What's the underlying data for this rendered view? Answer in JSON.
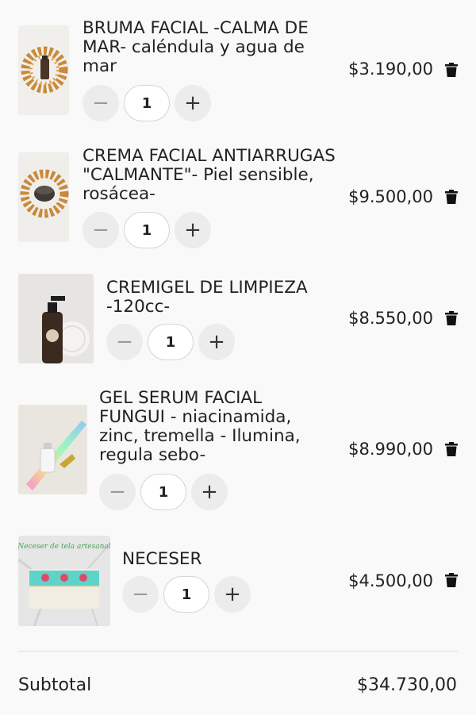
{
  "cart": {
    "items": [
      {
        "title": "BRUMA FACIAL -CALMA DE MAR- caléndula y agua de mar",
        "quantity": "1",
        "price": "$3.190,00"
      },
      {
        "title": "CREMA FACIAL ANTIARRUGAS \"CALMANTE\"- Piel sensible, rosácea-",
        "quantity": "1",
        "price": "$9.500,00"
      },
      {
        "title": "CREMIGEL DE LIMPIEZA -120cc-",
        "quantity": "1",
        "price": "$8.550,00"
      },
      {
        "title": "GEL SERUM FACIAL FUNGUI - niacinamida, zinc, tremella - Ilumina, regula sebo-",
        "quantity": "1",
        "price": "$8.990,00"
      },
      {
        "title": "NECESER",
        "quantity": "1",
        "price": "$4.500,00",
        "image_text": "Neceser de tela artesanal"
      }
    ],
    "subtotal_label": "Subtotal",
    "subtotal_value": "$34.730,00"
  },
  "icons": {
    "minus": "minus-icon",
    "plus": "plus-icon",
    "delete": "trash-icon"
  },
  "colors": {
    "background": "#f9f9f9",
    "button_bg": "#ececec",
    "text": "#222222"
  }
}
